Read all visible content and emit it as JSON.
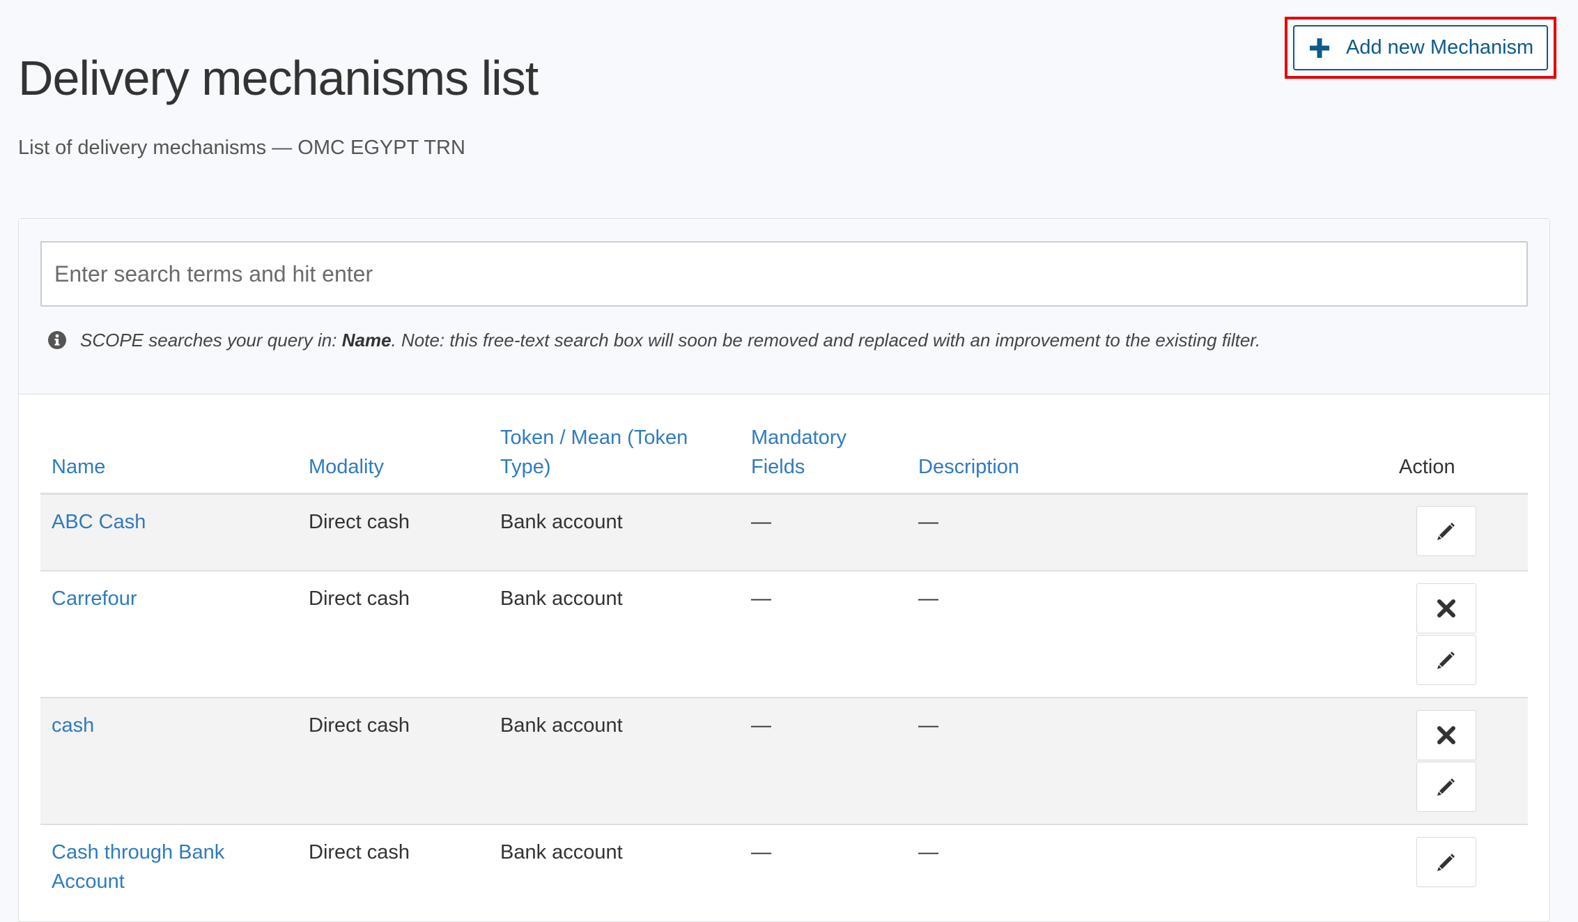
{
  "header": {
    "title": "Delivery mechanisms list",
    "subtitle": "List of delivery mechanisms — OMC EGYPT TRN",
    "add_button_label": "Add new Mechanism"
  },
  "search": {
    "placeholder": "Enter search terms and hit enter",
    "value": "",
    "note_prefix": "SCOPE searches your query in: ",
    "note_field": "Name",
    "note_suffix": ". Note: this free-text search box will soon be removed and replaced with an improvement to the existing filter."
  },
  "table": {
    "columns": {
      "name": "Name",
      "modality": "Modality",
      "token_line1": "Token / Mean (Token",
      "token_line2": "Type)",
      "mandatory_line1": "Mandatory",
      "mandatory_line2": "Fields",
      "description": "Description",
      "action": "Action"
    },
    "rows": [
      {
        "name_line1": "ABC Cash",
        "name_line2": "",
        "modality": "Direct cash",
        "token": "Bank account",
        "mandatory_fields": "—",
        "description": "—",
        "actions": [
          "edit"
        ]
      },
      {
        "name_line1": "Carrefour",
        "name_line2": "",
        "modality": "Direct cash",
        "token": "Bank account",
        "mandatory_fields": "—",
        "description": "—",
        "actions": [
          "delete",
          "edit"
        ]
      },
      {
        "name_line1": "cash",
        "name_line2": "",
        "modality": "Direct cash",
        "token": "Bank account",
        "mandatory_fields": "—",
        "description": "—",
        "actions": [
          "delete",
          "edit"
        ]
      },
      {
        "name_line1": "Cash through Bank",
        "name_line2": "Account",
        "modality": "Direct cash",
        "token": "Bank account",
        "mandatory_fields": "—",
        "description": "—",
        "actions": [
          "edit"
        ]
      }
    ]
  },
  "icons": {
    "add": "plus-icon",
    "info": "info-circle-icon",
    "delete": "close-icon",
    "edit": "pencil-icon"
  },
  "colors": {
    "link": "#2f7bbf",
    "primary_button": "#0c5a8c",
    "highlight_box": "#e60000",
    "page_background": "#f8f9fc",
    "stripe": "#f3f3f3"
  }
}
